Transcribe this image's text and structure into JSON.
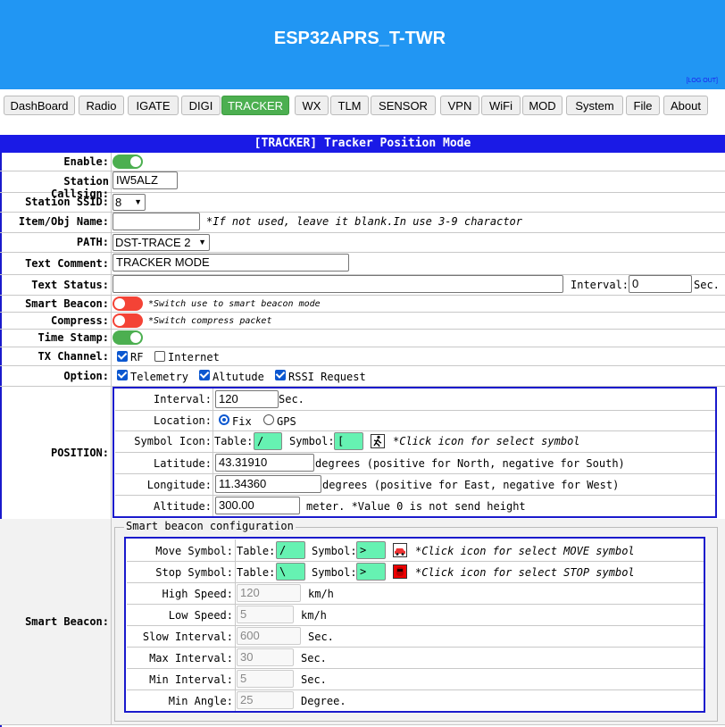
{
  "header": {
    "title": "ESP32APRS_T-TWR",
    "logout": "[LOG OUT]"
  },
  "tabs": [
    {
      "label": "DashBoard",
      "active": false
    },
    {
      "label": "Radio",
      "active": false
    },
    {
      "label": "IGATE",
      "active": false
    },
    {
      "label": "DIGI",
      "active": false
    },
    {
      "label": "TRACKER",
      "active": true
    },
    {
      "label": "WX",
      "active": false
    },
    {
      "label": "TLM",
      "active": false
    },
    {
      "label": "SENSOR",
      "active": false
    },
    {
      "label": "VPN",
      "active": false
    },
    {
      "label": "WiFi",
      "active": false
    },
    {
      "label": "MOD",
      "active": false
    },
    {
      "label": "System",
      "active": false
    },
    {
      "label": "File",
      "active": false
    },
    {
      "label": "About",
      "active": false
    }
  ],
  "panel": {
    "title": "[TRACKER] Tracker Position Mode"
  },
  "form": {
    "enable": {
      "label": "Enable:",
      "on": true
    },
    "callsign": {
      "label": "Station Callsign:",
      "value": "IW5ALZ"
    },
    "ssid": {
      "label": "Station SSID:",
      "value": "8"
    },
    "item": {
      "label": "Item/Obj Name:",
      "value": "",
      "note": "*If not used, leave it blank.In use 3-9 charactor"
    },
    "path": {
      "label": "PATH:",
      "value": "DST-TRACE 2"
    },
    "comment": {
      "label": "Text Comment:",
      "value": "TRACKER MODE"
    },
    "status": {
      "label": "Text Status:",
      "value": "",
      "interval_label": "Interval:",
      "interval_value": "0",
      "unit": "Sec."
    },
    "smart": {
      "label": "Smart Beacon:",
      "on": false,
      "note": "*Switch use to smart beacon mode"
    },
    "compress": {
      "label": "Compress:",
      "on": false,
      "note": "*Switch compress packet"
    },
    "timestamp": {
      "label": "Time Stamp:",
      "on": true
    },
    "txchannel": {
      "label": "TX Channel:",
      "rf": "RF",
      "rf_checked": true,
      "inet": "Internet",
      "inet_checked": false
    },
    "option": {
      "label": "Option:",
      "telemetry": "Telemetry",
      "altitude": "Altutude",
      "rssi": "RSSI Request"
    }
  },
  "position": {
    "label": "POSITION:",
    "interval": {
      "label": "Interval:",
      "value": "120",
      "unit": "Sec."
    },
    "location": {
      "label": "Location:",
      "fix": "Fix",
      "gps": "GPS",
      "selected": "Fix"
    },
    "symbol": {
      "label": "Symbol Icon:",
      "table_label": "Table:",
      "table": "/",
      "symbol_label": "Symbol:",
      "symbol": "[",
      "note": "*Click icon for select symbol",
      "icon": "runner-icon"
    },
    "latitude": {
      "label": "Latitude:",
      "value": "43.31910",
      "note": "degrees (positive for North, negative for South)"
    },
    "longitude": {
      "label": "Longitude:",
      "value": "11.34360",
      "note": "degrees (positive for East, negative for West)"
    },
    "altitude": {
      "label": "Altitude:",
      "value": "300.00",
      "note": "meter. *Value 0 is not send height"
    }
  },
  "smartbeacon": {
    "label": "Smart Beacon:",
    "legend": "Smart beacon configuration",
    "move": {
      "label": "Move Symbol:",
      "table_label": "Table:",
      "table": "/",
      "symbol_label": "Symbol:",
      "symbol": ">",
      "note": "*Click icon for select MOVE symbol",
      "icon": "car-icon"
    },
    "stop": {
      "label": "Stop Symbol:",
      "table_label": "Table:",
      "table": "\\",
      "symbol_label": "Symbol:",
      "symbol": ">",
      "note": "*Click icon for select STOP symbol",
      "icon": "stop-car-icon"
    },
    "high": {
      "label": "High Speed:",
      "value": "120",
      "unit": "km/h"
    },
    "low": {
      "label": "Low Speed:",
      "value": "5",
      "unit": "km/h"
    },
    "slow": {
      "label": "Slow Interval:",
      "value": "600",
      "unit": "Sec."
    },
    "max": {
      "label": "Max Interval:",
      "value": "30",
      "unit": "Sec."
    },
    "min": {
      "label": "Min Interval:",
      "value": "5",
      "unit": "Sec."
    },
    "angle": {
      "label": "Min Angle:",
      "value": "25",
      "unit": "Degree."
    }
  },
  "colors": {
    "header": "#2196f3",
    "active_tab": "#4caf50",
    "panel_border": "#1a1acc",
    "toggle_on": "#4caf50",
    "toggle_off": "#f44336",
    "symbol_field": "#66f2b2"
  }
}
